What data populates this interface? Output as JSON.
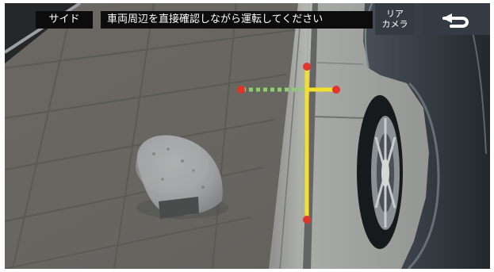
{
  "topbar": {
    "mode_label": "サイド",
    "warning_text": "車両周辺を直接確認しながら運転してください",
    "camera_button_label_line1": "リア",
    "camera_button_label_line2": "カメラ"
  },
  "guide_colors": {
    "green_guide": "#8bd06b",
    "yellow_guide": "#f2df2e",
    "marker_red": "#e2332d"
  },
  "icons": {
    "back": "u-turn-return-icon"
  }
}
